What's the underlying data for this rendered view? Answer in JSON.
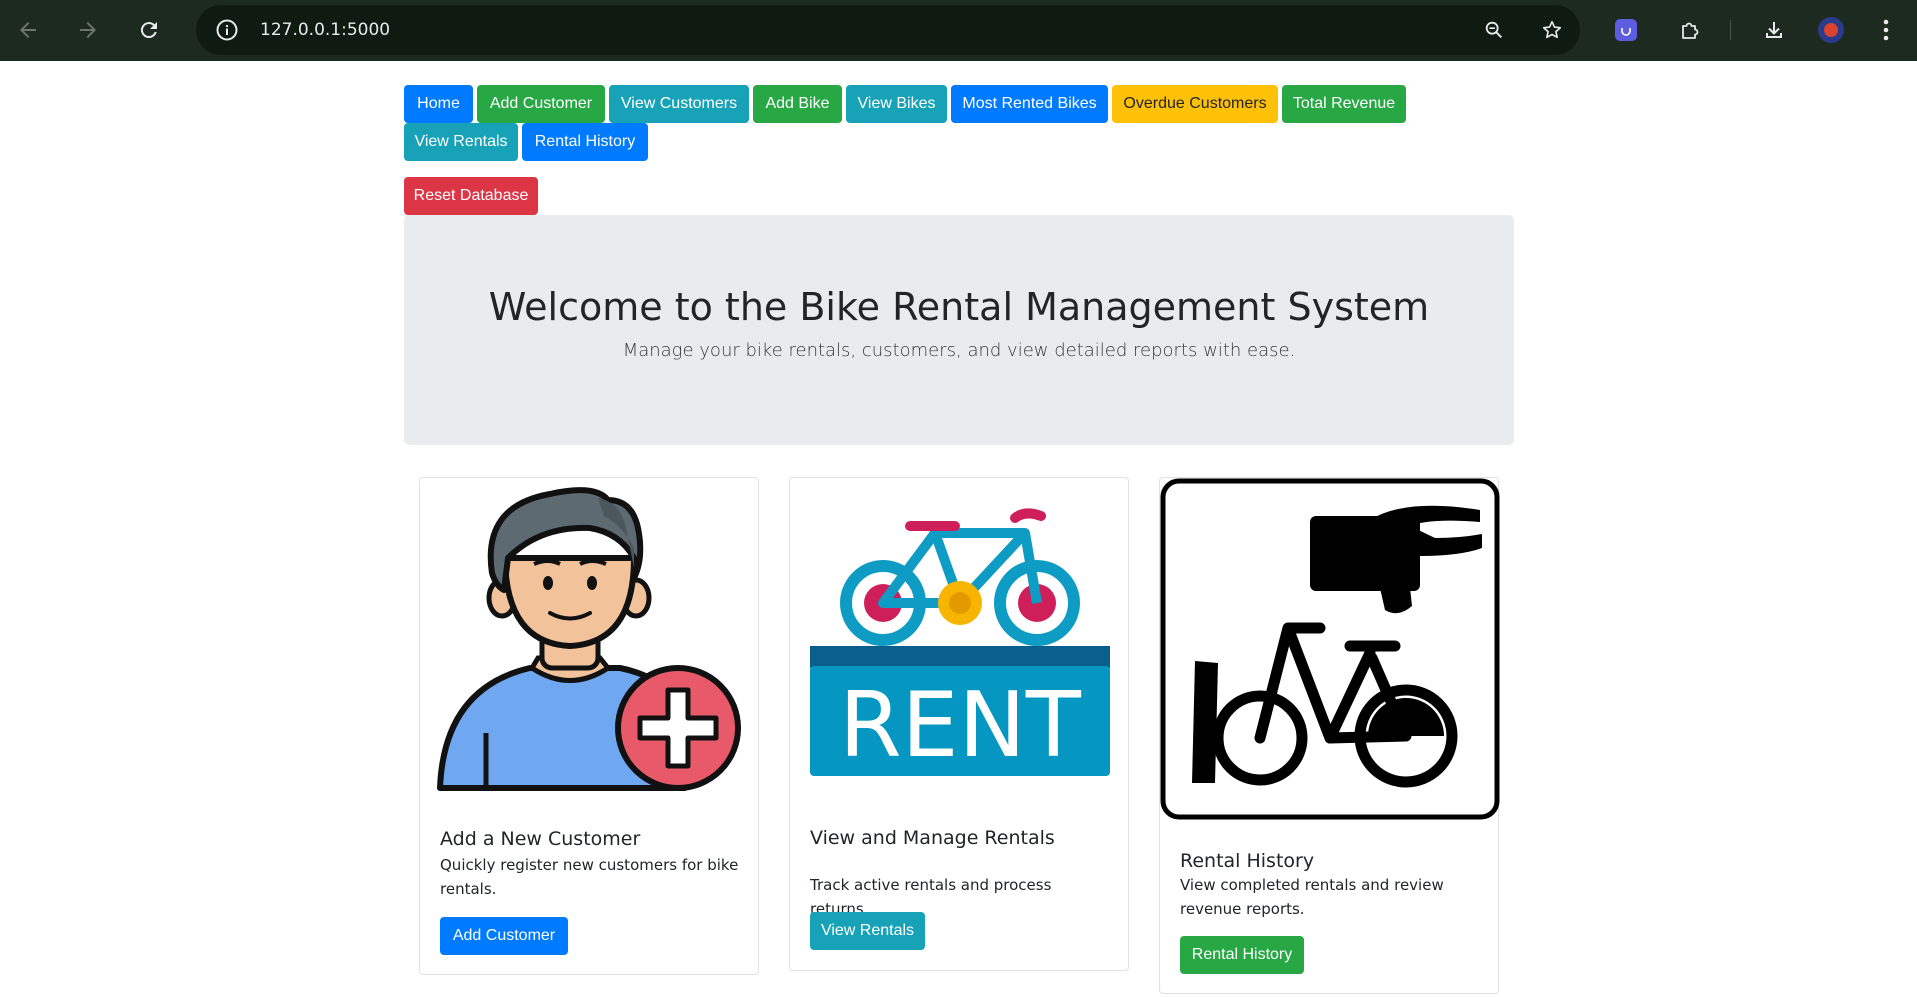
{
  "browser": {
    "url": "127.0.0.1:5000",
    "icons": [
      "back-icon",
      "forward-icon",
      "reload-icon",
      "site-info-icon",
      "zoom-icon",
      "bookmark-star-icon",
      "extension-app-icon",
      "extensions-puzzle-icon",
      "download-icon",
      "profile-avatar",
      "menu-kebab-icon"
    ]
  },
  "nav": {
    "home": "Home",
    "add_customer": "Add Customer",
    "view_customers": "View Customers",
    "add_bike": "Add Bike",
    "view_bikes": "View Bikes",
    "most_rented": "Most Rented Bikes",
    "overdue": "Overdue Customers",
    "total_revenue": "Total Revenue",
    "view_rentals": "View Rentals",
    "rental_history": "Rental History",
    "reset_db": "Reset Database"
  },
  "hero": {
    "title": "Welcome to the Bike Rental Management System",
    "subtitle": "Manage your bike rentals, customers, and view detailed reports with ease."
  },
  "cards": [
    {
      "title": "Add a New Customer",
      "text": "Quickly register new customers for bike rentals.",
      "button": "Add Customer",
      "image": "add-customer-illustration"
    },
    {
      "title": "View and Manage Rentals",
      "text": "Track active rentals and process returns.",
      "button": "View Rentals",
      "image": "rent-bicycle-illustration",
      "image_text": "RENT"
    },
    {
      "title": "Rental History",
      "text": "View completed rentals and review revenue reports.",
      "button": "Rental History",
      "image": "bike-rental-sign-illustration"
    }
  ],
  "colors": {
    "primary": "#007bff",
    "success": "#28a745",
    "info": "#17a2b8",
    "warning": "#ffc107",
    "danger": "#dc3545",
    "jumbotron": "#e9ecef"
  }
}
